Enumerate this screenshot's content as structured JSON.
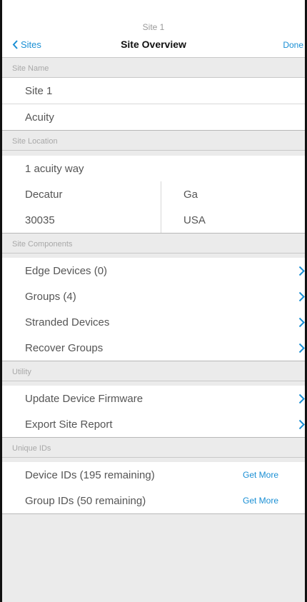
{
  "header": {
    "subtitle": "Site 1",
    "title": "Site Overview",
    "back_label": "Sites",
    "done_label": "Done"
  },
  "sections": {
    "site_name": {
      "header": "Site Name",
      "name_value": "Site 1",
      "org_value": "Acuity"
    },
    "site_location": {
      "header": "Site Location",
      "street": "1 acuity way",
      "city": "Decatur",
      "state": "Ga",
      "zip": "30035",
      "country": "USA"
    },
    "site_components": {
      "header": "Site Components",
      "items": [
        {
          "label": "Edge Devices (0)"
        },
        {
          "label": "Groups (4)"
        },
        {
          "label": "Stranded Devices"
        },
        {
          "label": "Recover Groups"
        }
      ]
    },
    "utility": {
      "header": "Utility",
      "items": [
        {
          "label": "Update Device Firmware"
        },
        {
          "label": "Export Site Report"
        }
      ]
    },
    "unique_ids": {
      "header": "Unique IDs",
      "device_ids": {
        "label": "Device IDs (195 remaining)",
        "action": "Get More"
      },
      "group_ids": {
        "label": "Group IDs (50 remaining)",
        "action": "Get More"
      }
    }
  },
  "colors": {
    "accent": "#1a8fd4",
    "background": "#ebebeb",
    "row_background": "#ffffff"
  },
  "icons": {
    "back": "chevron-left-icon",
    "disclosure": "chevron-right-icon"
  }
}
